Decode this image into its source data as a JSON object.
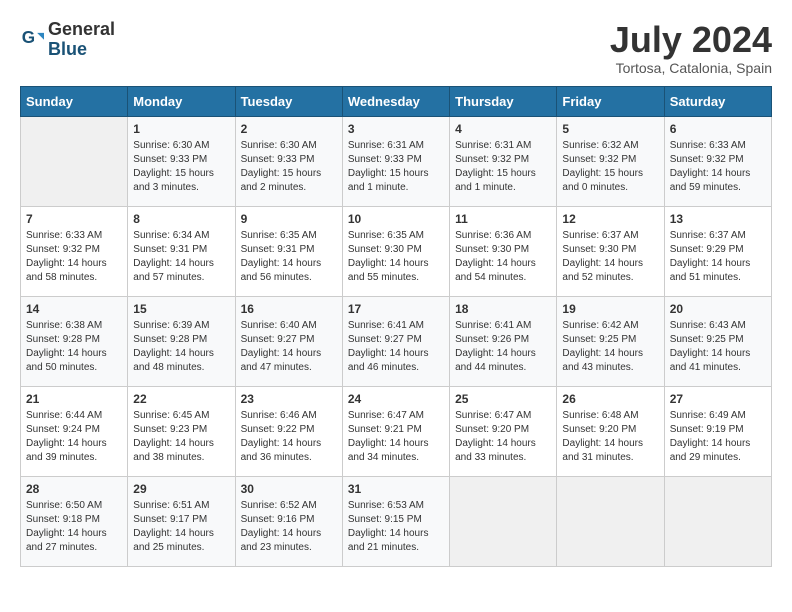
{
  "header": {
    "logo_general": "General",
    "logo_blue": "Blue",
    "month_title": "July 2024",
    "location": "Tortosa, Catalonia, Spain"
  },
  "days_of_week": [
    "Sunday",
    "Monday",
    "Tuesday",
    "Wednesday",
    "Thursday",
    "Friday",
    "Saturday"
  ],
  "weeks": [
    [
      {
        "day": "",
        "sunrise": "",
        "sunset": "",
        "daylight": "",
        "empty": true
      },
      {
        "day": "1",
        "sunrise": "Sunrise: 6:30 AM",
        "sunset": "Sunset: 9:33 PM",
        "daylight": "Daylight: 15 hours and 3 minutes.",
        "empty": false
      },
      {
        "day": "2",
        "sunrise": "Sunrise: 6:30 AM",
        "sunset": "Sunset: 9:33 PM",
        "daylight": "Daylight: 15 hours and 2 minutes.",
        "empty": false
      },
      {
        "day": "3",
        "sunrise": "Sunrise: 6:31 AM",
        "sunset": "Sunset: 9:33 PM",
        "daylight": "Daylight: 15 hours and 1 minute.",
        "empty": false
      },
      {
        "day": "4",
        "sunrise": "Sunrise: 6:31 AM",
        "sunset": "Sunset: 9:32 PM",
        "daylight": "Daylight: 15 hours and 1 minute.",
        "empty": false
      },
      {
        "day": "5",
        "sunrise": "Sunrise: 6:32 AM",
        "sunset": "Sunset: 9:32 PM",
        "daylight": "Daylight: 15 hours and 0 minutes.",
        "empty": false
      },
      {
        "day": "6",
        "sunrise": "Sunrise: 6:33 AM",
        "sunset": "Sunset: 9:32 PM",
        "daylight": "Daylight: 14 hours and 59 minutes.",
        "empty": false
      }
    ],
    [
      {
        "day": "7",
        "sunrise": "Sunrise: 6:33 AM",
        "sunset": "Sunset: 9:32 PM",
        "daylight": "Daylight: 14 hours and 58 minutes.",
        "empty": false
      },
      {
        "day": "8",
        "sunrise": "Sunrise: 6:34 AM",
        "sunset": "Sunset: 9:31 PM",
        "daylight": "Daylight: 14 hours and 57 minutes.",
        "empty": false
      },
      {
        "day": "9",
        "sunrise": "Sunrise: 6:35 AM",
        "sunset": "Sunset: 9:31 PM",
        "daylight": "Daylight: 14 hours and 56 minutes.",
        "empty": false
      },
      {
        "day": "10",
        "sunrise": "Sunrise: 6:35 AM",
        "sunset": "Sunset: 9:30 PM",
        "daylight": "Daylight: 14 hours and 55 minutes.",
        "empty": false
      },
      {
        "day": "11",
        "sunrise": "Sunrise: 6:36 AM",
        "sunset": "Sunset: 9:30 PM",
        "daylight": "Daylight: 14 hours and 54 minutes.",
        "empty": false
      },
      {
        "day": "12",
        "sunrise": "Sunrise: 6:37 AM",
        "sunset": "Sunset: 9:30 PM",
        "daylight": "Daylight: 14 hours and 52 minutes.",
        "empty": false
      },
      {
        "day": "13",
        "sunrise": "Sunrise: 6:37 AM",
        "sunset": "Sunset: 9:29 PM",
        "daylight": "Daylight: 14 hours and 51 minutes.",
        "empty": false
      }
    ],
    [
      {
        "day": "14",
        "sunrise": "Sunrise: 6:38 AM",
        "sunset": "Sunset: 9:28 PM",
        "daylight": "Daylight: 14 hours and 50 minutes.",
        "empty": false
      },
      {
        "day": "15",
        "sunrise": "Sunrise: 6:39 AM",
        "sunset": "Sunset: 9:28 PM",
        "daylight": "Daylight: 14 hours and 48 minutes.",
        "empty": false
      },
      {
        "day": "16",
        "sunrise": "Sunrise: 6:40 AM",
        "sunset": "Sunset: 9:27 PM",
        "daylight": "Daylight: 14 hours and 47 minutes.",
        "empty": false
      },
      {
        "day": "17",
        "sunrise": "Sunrise: 6:41 AM",
        "sunset": "Sunset: 9:27 PM",
        "daylight": "Daylight: 14 hours and 46 minutes.",
        "empty": false
      },
      {
        "day": "18",
        "sunrise": "Sunrise: 6:41 AM",
        "sunset": "Sunset: 9:26 PM",
        "daylight": "Daylight: 14 hours and 44 minutes.",
        "empty": false
      },
      {
        "day": "19",
        "sunrise": "Sunrise: 6:42 AM",
        "sunset": "Sunset: 9:25 PM",
        "daylight": "Daylight: 14 hours and 43 minutes.",
        "empty": false
      },
      {
        "day": "20",
        "sunrise": "Sunrise: 6:43 AM",
        "sunset": "Sunset: 9:25 PM",
        "daylight": "Daylight: 14 hours and 41 minutes.",
        "empty": false
      }
    ],
    [
      {
        "day": "21",
        "sunrise": "Sunrise: 6:44 AM",
        "sunset": "Sunset: 9:24 PM",
        "daylight": "Daylight: 14 hours and 39 minutes.",
        "empty": false
      },
      {
        "day": "22",
        "sunrise": "Sunrise: 6:45 AM",
        "sunset": "Sunset: 9:23 PM",
        "daylight": "Daylight: 14 hours and 38 minutes.",
        "empty": false
      },
      {
        "day": "23",
        "sunrise": "Sunrise: 6:46 AM",
        "sunset": "Sunset: 9:22 PM",
        "daylight": "Daylight: 14 hours and 36 minutes.",
        "empty": false
      },
      {
        "day": "24",
        "sunrise": "Sunrise: 6:47 AM",
        "sunset": "Sunset: 9:21 PM",
        "daylight": "Daylight: 14 hours and 34 minutes.",
        "empty": false
      },
      {
        "day": "25",
        "sunrise": "Sunrise: 6:47 AM",
        "sunset": "Sunset: 9:20 PM",
        "daylight": "Daylight: 14 hours and 33 minutes.",
        "empty": false
      },
      {
        "day": "26",
        "sunrise": "Sunrise: 6:48 AM",
        "sunset": "Sunset: 9:20 PM",
        "daylight": "Daylight: 14 hours and 31 minutes.",
        "empty": false
      },
      {
        "day": "27",
        "sunrise": "Sunrise: 6:49 AM",
        "sunset": "Sunset: 9:19 PM",
        "daylight": "Daylight: 14 hours and 29 minutes.",
        "empty": false
      }
    ],
    [
      {
        "day": "28",
        "sunrise": "Sunrise: 6:50 AM",
        "sunset": "Sunset: 9:18 PM",
        "daylight": "Daylight: 14 hours and 27 minutes.",
        "empty": false
      },
      {
        "day": "29",
        "sunrise": "Sunrise: 6:51 AM",
        "sunset": "Sunset: 9:17 PM",
        "daylight": "Daylight: 14 hours and 25 minutes.",
        "empty": false
      },
      {
        "day": "30",
        "sunrise": "Sunrise: 6:52 AM",
        "sunset": "Sunset: 9:16 PM",
        "daylight": "Daylight: 14 hours and 23 minutes.",
        "empty": false
      },
      {
        "day": "31",
        "sunrise": "Sunrise: 6:53 AM",
        "sunset": "Sunset: 9:15 PM",
        "daylight": "Daylight: 14 hours and 21 minutes.",
        "empty": false
      },
      {
        "day": "",
        "sunrise": "",
        "sunset": "",
        "daylight": "",
        "empty": true
      },
      {
        "day": "",
        "sunrise": "",
        "sunset": "",
        "daylight": "",
        "empty": true
      },
      {
        "day": "",
        "sunrise": "",
        "sunset": "",
        "daylight": "",
        "empty": true
      }
    ]
  ]
}
